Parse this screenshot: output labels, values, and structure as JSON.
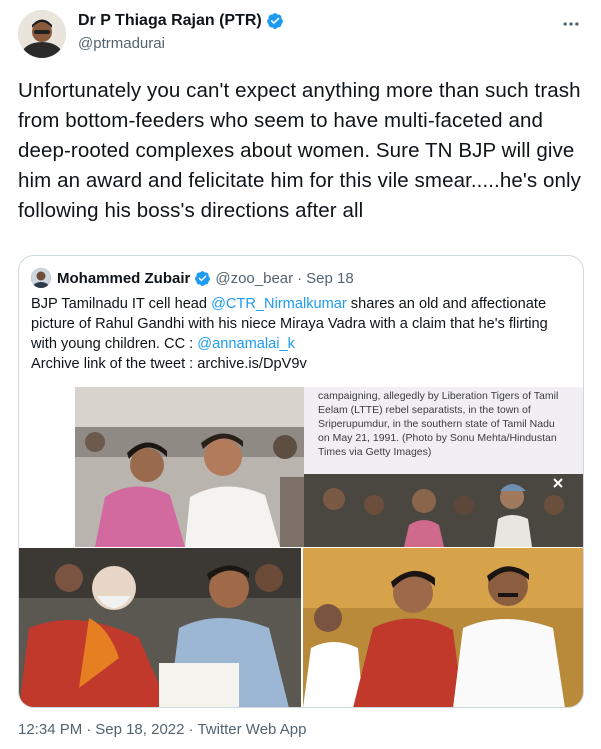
{
  "author": {
    "display_name": "Dr P Thiaga Rajan (PTR)",
    "handle": "@ptrmadurai",
    "verified_icon": "verified-badge-icon"
  },
  "tweet": {
    "text": "Unfortunately you can't expect anything more than such trash from bottom-feeders who seem to have multi-faceted and deep-rooted complexes about women. Sure TN BJP will give him an award and felicitate him for this vile smear.....he's only following his boss's directions after all"
  },
  "quoted": {
    "display_name": "Mohammed Zubair",
    "handle": "@zoo_bear",
    "dot": "·",
    "date": "Sep 18",
    "text_parts": {
      "p1": "BJP Tamilnadu IT cell head ",
      "mention1": "@CTR_Nirmalkumar",
      "p2": " shares an old and affectionate picture of Rahul Gandhi with his niece Miraya Vadra with a claim that he's flirting with young children. CC : ",
      "mention2": "@annamalai_k",
      "p3": "Archive link of the tweet : archive.is/DpV9v"
    },
    "image_caption": "campaigning, allegedly by Liberation Tigers of Tamil Eelam (LTTE) rebel separatists, in the town of Sriperupumdur, in the southern state of Tamil Nadu on May 21, 1991. (Photo by Sonu Mehta/Hindustan Times via Getty Images)"
  },
  "meta": {
    "time": "12:34 PM",
    "dot1": "·",
    "date": "Sep 18, 2022",
    "dot2": "·",
    "source": "Twitter Web App"
  },
  "colors": {
    "accent": "#1d9bf0",
    "text": "#0f1419",
    "secondary": "#536471",
    "border": "#cfd9de"
  }
}
